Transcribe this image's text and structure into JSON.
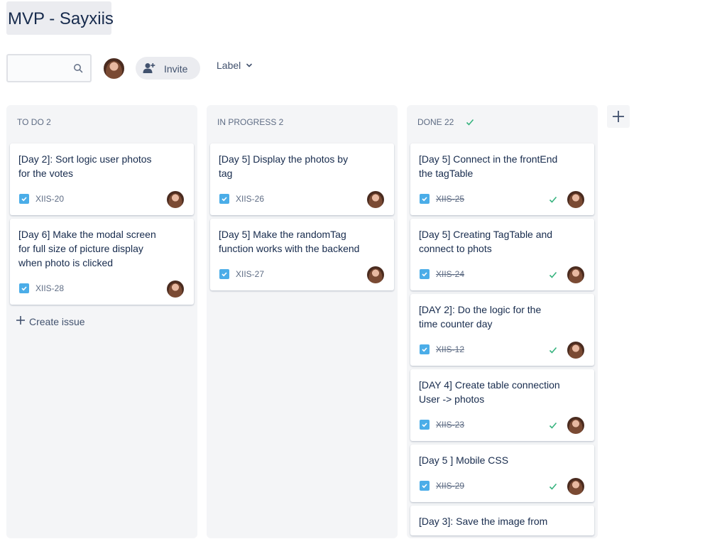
{
  "board": {
    "title": "MVP - Sayxiis"
  },
  "toolbar": {
    "search_placeholder": "",
    "invite_label": "Invite",
    "label_filter": "Label"
  },
  "colors": {
    "story": "#4bade8",
    "done_check": "#36b37e",
    "text": "#172b4d",
    "muted": "#5e6c84",
    "column_bg": "#f4f5f7"
  },
  "columns": [
    {
      "title": "TO DO 2",
      "cards": [
        {
          "title": "[Day 2]: Sort logic user photos for the votes",
          "key": "XIIS-20",
          "done": false
        },
        {
          "title": "[Day 6] Make the modal screen for full size of picture display when photo is clicked",
          "key": "XIIS-28",
          "done": false
        }
      ],
      "create_label": "Create issue"
    },
    {
      "title": "IN PROGRESS 2",
      "cards": [
        {
          "title": "[Day 5] Display the photos by tag",
          "key": "XIIS-26",
          "done": false
        },
        {
          "title": "[Day 5] Make the randomTag function works with the backend",
          "key": "XIIS-27",
          "done": false
        }
      ]
    },
    {
      "title": "DONE 22",
      "cards": [
        {
          "title": "[Day 5] Connect in the frontEnd the tagTable",
          "key": "XIIS-25",
          "done": true
        },
        {
          "title": "[Day 5] Creating TagTable and connect to phots",
          "key": "XIIS-24",
          "done": true
        },
        {
          "title": "[DAY 2]: Do the logic for the time counter day",
          "key": "XIIS-12",
          "done": true
        },
        {
          "title": "[DAY 4] Create table connection User -> photos",
          "key": "XIIS-23",
          "done": true
        },
        {
          "title": "[Day 5 ] Mobile CSS",
          "key": "XIIS-29",
          "done": true
        },
        {
          "title": "[Day 3]: Save the image from",
          "key": "",
          "done": true
        }
      ]
    }
  ]
}
